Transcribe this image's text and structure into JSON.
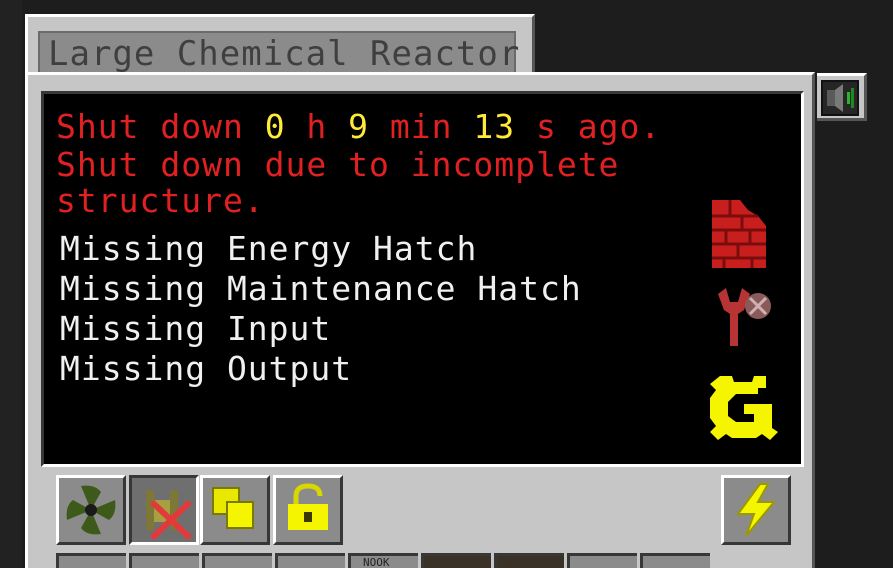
{
  "window": {
    "title": "Large Chemical Reactor"
  },
  "status": {
    "shutdown_prefix": "Shut down ",
    "hours": "0",
    "hours_unit": " h ",
    "minutes": "9",
    "minutes_unit": " min ",
    "seconds": "13",
    "seconds_unit": " s ago.",
    "reason_line1": "Shut down due to incomplete",
    "reason_line2": "structure."
  },
  "missing": [
    "Missing Energy Hatch",
    "Missing Maintenance Hatch",
    "Missing Input",
    "Missing Output"
  ],
  "slots": {
    "slot5_label": "NOOK"
  },
  "colors": {
    "error_red": "#e12121",
    "value_yellow": "#ffea3a",
    "text_white": "#f0f0f0",
    "gui_gray": "#c6c6c6"
  },
  "icons": {
    "structure": "red-brick-icon",
    "maintenance": "wrench-icon",
    "gregtech": "gregtech-logo-icon",
    "void_protection": "void-protection-icon",
    "input_separation": "input-separation-icon",
    "batch_mode": "batch-mode-icon",
    "lock": "lock-icon",
    "power": "power-switch-icon",
    "sound": "speaker-icon"
  }
}
